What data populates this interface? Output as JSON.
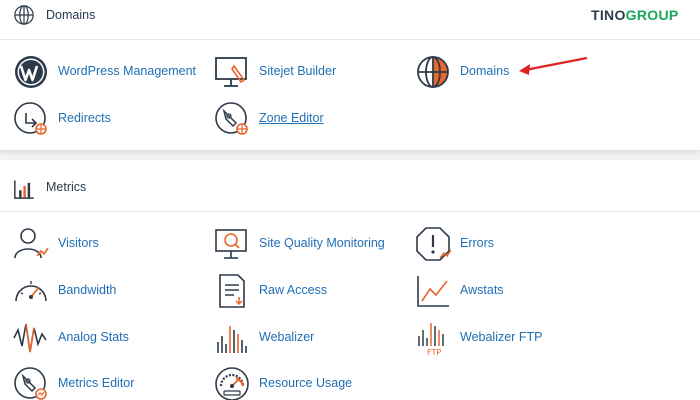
{
  "brand": {
    "part1": "TINO",
    "part2": "GROUP"
  },
  "colors": {
    "accent_orange": "#e8652b",
    "link_blue": "#1f6fb6",
    "icon_dark": "#2d3a4a",
    "brand_green": "#19a65b",
    "arrow_red": "#e02424"
  },
  "domains_section": {
    "title": "Domains",
    "icon": "globe-icon",
    "items": [
      {
        "label": "WordPress Management",
        "icon": "wordpress-icon"
      },
      {
        "label": "Sitejet Builder",
        "icon": "sitejet-icon"
      },
      {
        "label": "Domains",
        "icon": "globe-icon"
      },
      {
        "label": "Redirects",
        "icon": "redirect-icon"
      },
      {
        "label": "Zone Editor",
        "icon": "zone-editor-icon"
      }
    ]
  },
  "metrics_section": {
    "title": "Metrics",
    "icon": "bar-chart-icon",
    "items": [
      {
        "label": "Visitors",
        "icon": "visitors-icon"
      },
      {
        "label": "Site Quality Monitoring",
        "icon": "site-quality-icon"
      },
      {
        "label": "Errors",
        "icon": "errors-icon"
      },
      {
        "label": "Bandwidth",
        "icon": "bandwidth-icon"
      },
      {
        "label": "Raw Access",
        "icon": "raw-access-icon"
      },
      {
        "label": "Awstats",
        "icon": "awstats-icon"
      },
      {
        "label": "Analog Stats",
        "icon": "analog-stats-icon"
      },
      {
        "label": "Webalizer",
        "icon": "webalizer-icon"
      },
      {
        "label": "Webalizer FTP",
        "icon": "webalizer-ftp-icon"
      },
      {
        "label": "Metrics Editor",
        "icon": "metrics-editor-icon"
      },
      {
        "label": "Resource Usage",
        "icon": "resource-usage-icon"
      }
    ]
  },
  "webalizer_ftp_tag": "FTP"
}
